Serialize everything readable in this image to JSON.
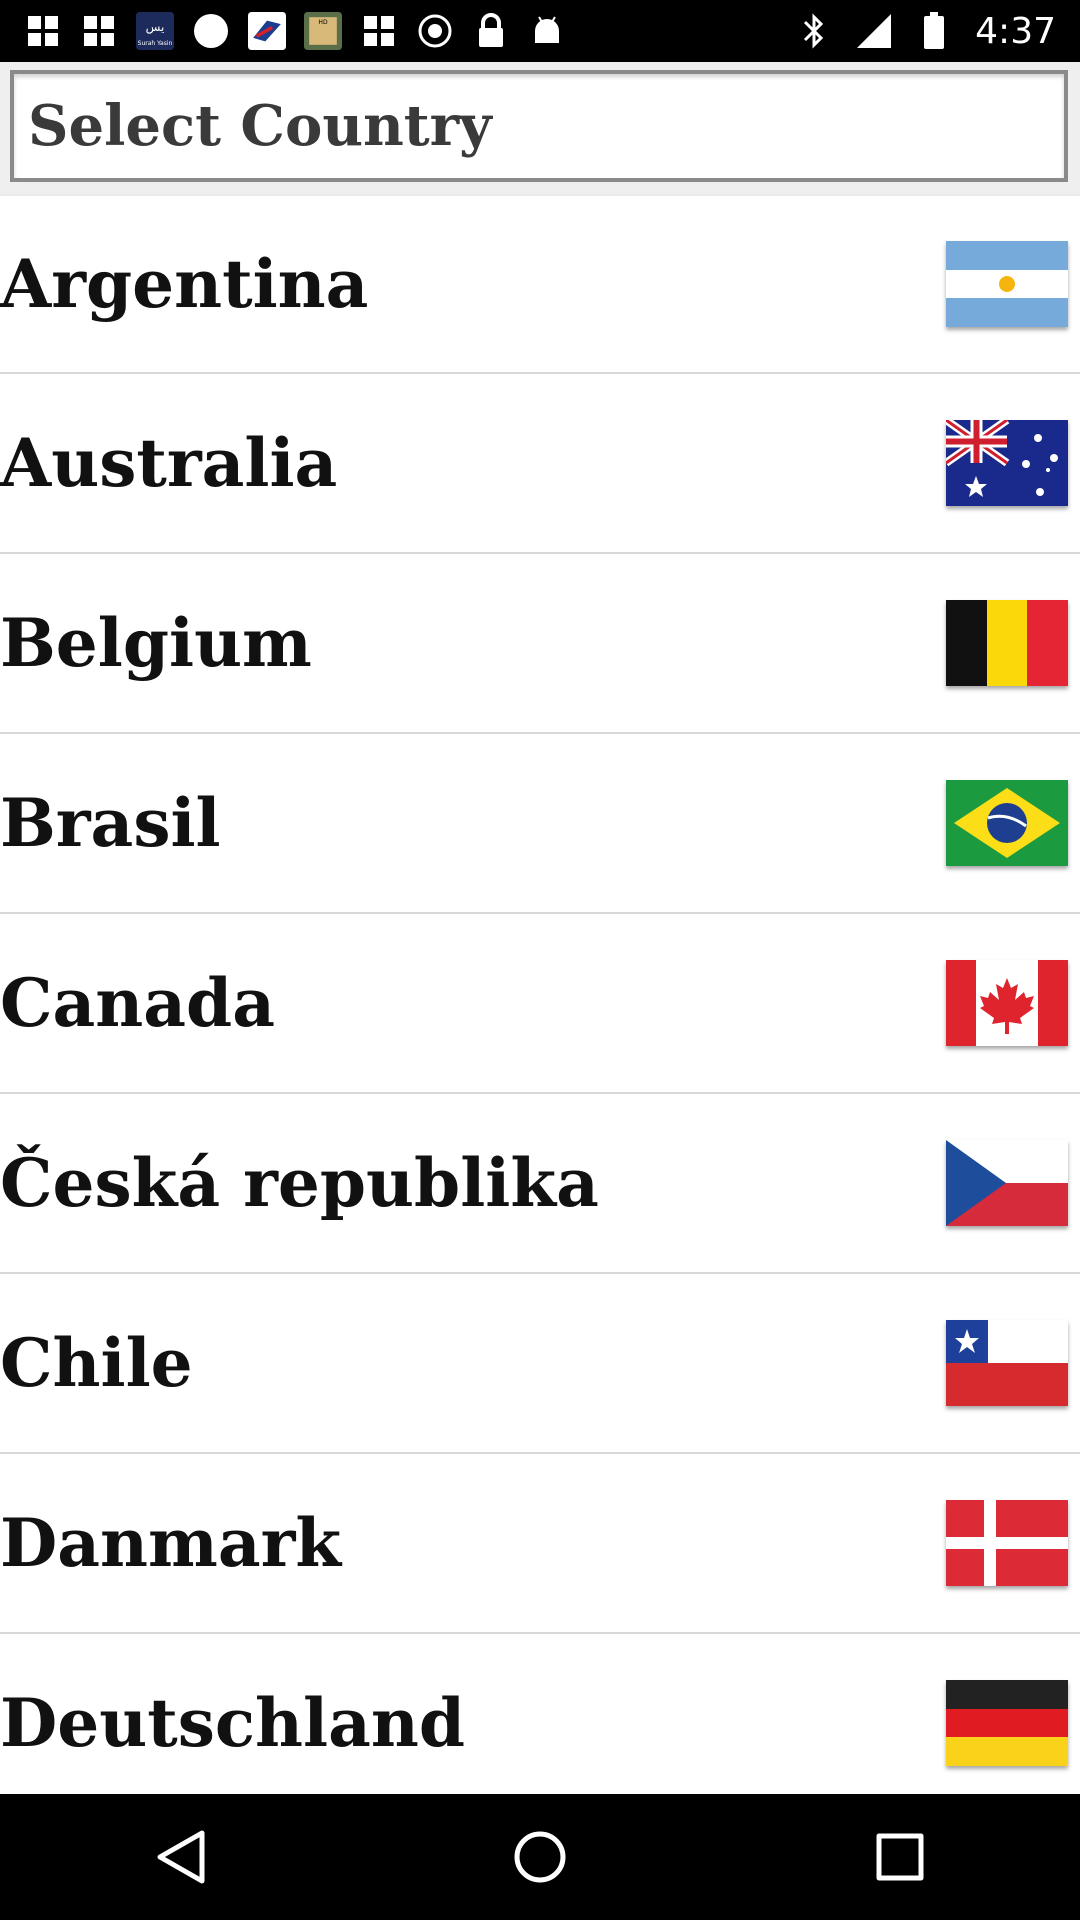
{
  "status_bar": {
    "time": "4:37",
    "left_icons": [
      "grid-icon",
      "grid-icon",
      "sarah-yasin-app-icon",
      "circle-icon",
      "airline-app-icon",
      "hd-photo-app-icon",
      "grid-icon",
      "update-icon",
      "lock-icon",
      "android-icon"
    ],
    "sarah_yasin_text": "Surah Yasin",
    "right_icons": [
      "bluetooth-icon",
      "signal-icon",
      "battery-icon"
    ]
  },
  "search": {
    "placeholder": "Select Country",
    "value": ""
  },
  "countries": [
    {
      "name": "Argentina",
      "flag": "argentina-flag-icon"
    },
    {
      "name": "Australia",
      "flag": "australia-flag-icon"
    },
    {
      "name": "Belgium",
      "flag": "belgium-flag-icon"
    },
    {
      "name": "Brasil",
      "flag": "brazil-flag-icon"
    },
    {
      "name": "Canada",
      "flag": "canada-flag-icon"
    },
    {
      "name": "Česká republika",
      "flag": "czech-flag-icon"
    },
    {
      "name": "Chile",
      "flag": "chile-flag-icon"
    },
    {
      "name": "Danmark",
      "flag": "denmark-flag-icon"
    },
    {
      "name": "Deutschland",
      "flag": "germany-flag-icon"
    }
  ],
  "nav_bar": {
    "buttons": [
      "back-icon",
      "home-icon",
      "recents-icon"
    ]
  },
  "colors": {
    "status_bar_bg": "#000000",
    "header_bg": "#efefef",
    "row_divider": "#d8d8d8",
    "label_text": "#111111"
  }
}
